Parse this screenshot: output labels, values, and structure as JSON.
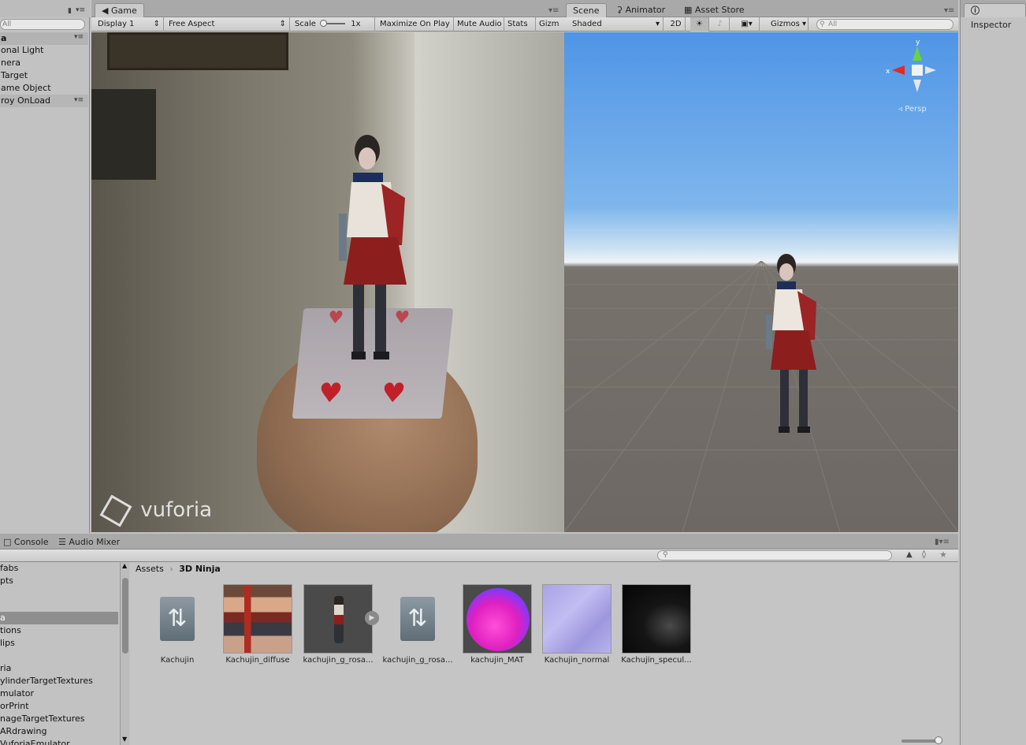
{
  "hierarchy": {
    "search_placeholder": "All",
    "scene_name": "a",
    "items": [
      "onal Light",
      "nera",
      "Target",
      "ame Object",
      "roy OnLoad"
    ]
  },
  "game": {
    "tab_label": "Game",
    "display": "Display 1",
    "aspect": "Free Aspect",
    "scale_label": "Scale",
    "scale_value": "1x",
    "maximize": "Maximize On Play",
    "mute": "Mute Audio",
    "stats": "Stats",
    "gizmos": "Gizm",
    "watermark": "vuforia"
  },
  "scene": {
    "tabs": [
      "Scene",
      "Animator",
      "Asset Store"
    ],
    "shading": "Shaded",
    "mode_2d": "2D",
    "gizmos": "Gizmos",
    "search_placeholder": "All",
    "persp_label": "Persp",
    "axis_y": "y",
    "axis_x": "x"
  },
  "inspector": {
    "tab_label": "Inspector"
  },
  "bottom": {
    "tabs": [
      "Console",
      "Audio Mixer"
    ],
    "breadcrumb_root": "Assets",
    "breadcrumb_current": "3D Ninja",
    "folders": [
      "fabs",
      "pts",
      "",
      "",
      "a",
      "tions",
      "lips",
      "",
      "ria",
      "ylinderTargetTextures",
      "mulator",
      "orPrint",
      "nageTargetTextures",
      "ARdrawing",
      "VuforiaEmulator"
    ],
    "assets": [
      "Kachujin",
      "Kachujin_diffuse",
      "kachujin_g_rosa...",
      "kachujin_g_rosa...",
      "kachujin_MAT",
      "Kachujin_normal",
      "Kachujin_specul..."
    ]
  },
  "colors": {
    "panel_bg": "#c2c2c2",
    "selection": "#8f8f8f",
    "sky_top": "#5fa0e8",
    "ground": "#6e6a66"
  }
}
